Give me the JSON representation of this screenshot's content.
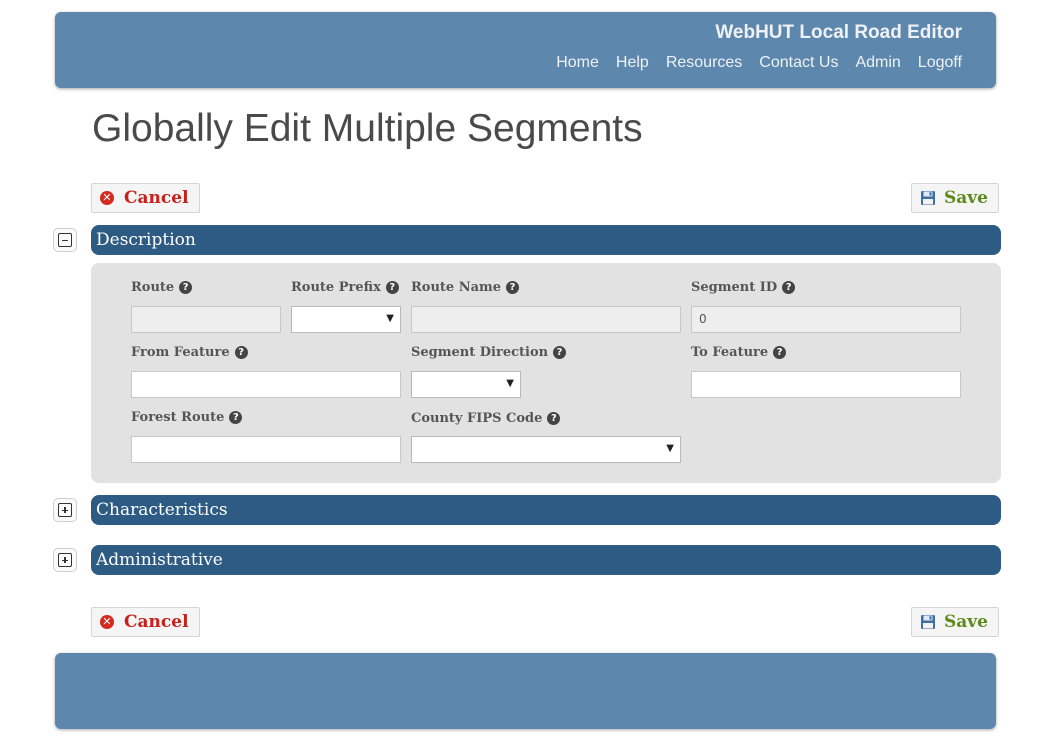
{
  "header": {
    "app_title": "WebHUT Local Road Editor",
    "nav": [
      "Home",
      "Help",
      "Resources",
      "Contact Us",
      "Admin",
      "Logoff"
    ]
  },
  "page_title": "Globally Edit Multiple Segments",
  "buttons": {
    "cancel": "Cancel",
    "save": "Save"
  },
  "sections": {
    "description": {
      "title": "Description",
      "expanded": true,
      "fields": {
        "route": {
          "label": "Route",
          "value": ""
        },
        "route_prefix": {
          "label": "Route Prefix",
          "value": ""
        },
        "route_name": {
          "label": "Route Name",
          "value": ""
        },
        "segment_id": {
          "label": "Segment ID",
          "value": "0"
        },
        "from_feature": {
          "label": "From Feature",
          "value": ""
        },
        "segment_direction": {
          "label": "Segment Direction",
          "value": ""
        },
        "to_feature": {
          "label": "To Feature",
          "value": ""
        },
        "forest_route": {
          "label": "Forest Route",
          "value": ""
        },
        "county_fips_code": {
          "label": "County FIPS Code",
          "value": ""
        }
      }
    },
    "characteristics": {
      "title": "Characteristics",
      "expanded": false
    },
    "administrative": {
      "title": "Administrative",
      "expanded": false
    }
  },
  "colors": {
    "header_bg": "#5e87ad",
    "section_bar": "#2e5b84",
    "cancel_red": "#c8201a",
    "save_green": "#5d8a1c",
    "panel_bg": "#e2e2e2"
  },
  "icons": [
    "cancel-icon",
    "save-icon",
    "help-icon",
    "collapse-icon",
    "expand-icon",
    "dropdown-arrow-icon"
  ]
}
